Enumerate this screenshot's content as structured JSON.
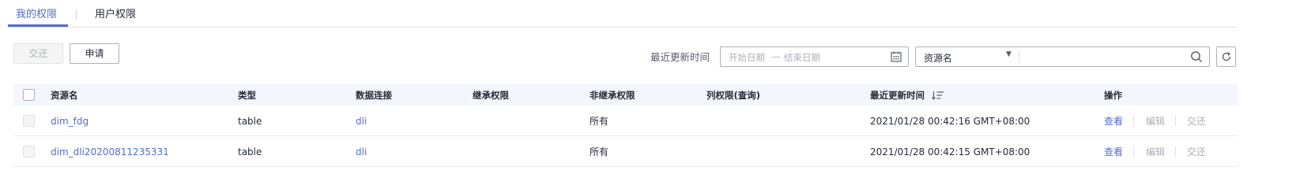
{
  "tabs": [
    {
      "label": "我的权限",
      "active": true
    },
    {
      "label": "用户权限",
      "active": false
    }
  ],
  "toolbar": {
    "return_label": "交还",
    "apply_label": "申请"
  },
  "filter": {
    "label": "最近更新时间",
    "start_placeholder": "开始日期",
    "range_sep": "—",
    "end_placeholder": "结束日期",
    "select_value": "资源名",
    "search_value": ""
  },
  "table": {
    "columns": [
      "资源名",
      "类型",
      "数据连接",
      "继承权限",
      "非继承权限",
      "列权限(查询)",
      "最近更新时间",
      "操作"
    ],
    "rows": [
      {
        "name": "dim_fdg",
        "type": "table",
        "connection": "dli",
        "inherited": "",
        "non_inherited": "所有",
        "column_perm": "",
        "updated": "2021/01/28 00:42:16 GMT+08:00"
      },
      {
        "name": "dim_dli20200811235331",
        "type": "table",
        "connection": "dli",
        "inherited": "",
        "non_inherited": "所有",
        "column_perm": "",
        "updated": "2021/01/28 00:42:15 GMT+08:00"
      }
    ],
    "actions": {
      "view": "查看",
      "edit": "编辑",
      "return": "交还"
    }
  },
  "colors": {
    "accent": "#526ecc",
    "header_bg": "#f3f6fd",
    "disabled": "#adb0b8"
  },
  "icons": [
    "calendar-icon",
    "search-icon",
    "refresh-icon",
    "sort-icon",
    "caret-down-icon"
  ]
}
